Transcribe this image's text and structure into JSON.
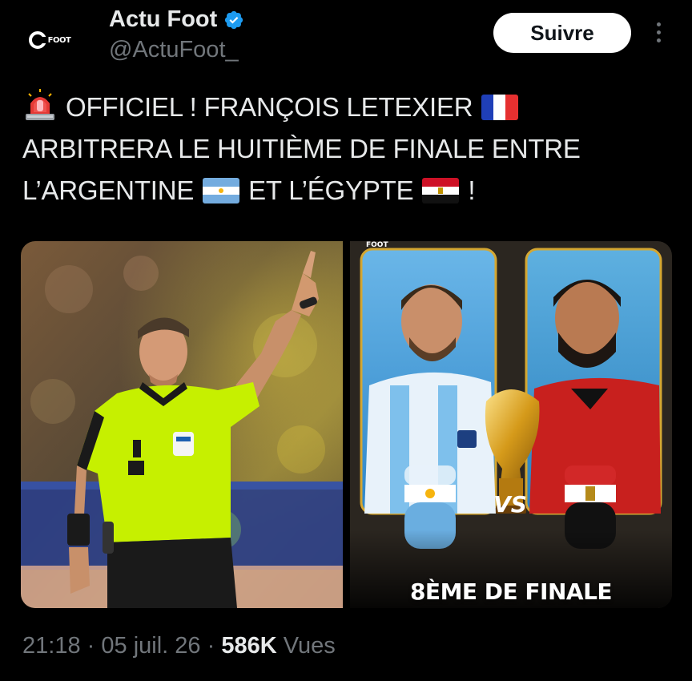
{
  "author": {
    "display_name": "Actu Foot",
    "handle": "@ActuFoot_",
    "avatar_logo_text": "FOOT",
    "verified": true
  },
  "follow_button": {
    "label": "Suivre"
  },
  "tweet": {
    "line1_text": "OFFICIEL ! FRANÇOIS LETEXIER",
    "line2_text": "ARBITRERA LE HUITIÈME DE FINALE ENTRE",
    "line3_part1": "L’ARGENTINE",
    "line3_part2": "ET L’ÉGYPTE",
    "line3_part3": "!",
    "emojis": [
      "siren-icon",
      "flag-france-icon",
      "flag-argentina-icon",
      "flag-egypt-icon"
    ]
  },
  "media": {
    "right_graphic": {
      "logo_text": "FOOT",
      "vs_text": "VS",
      "title": "8ÈME DE FINALE"
    }
  },
  "meta": {
    "time": "21:18",
    "date": "05 juil. 26",
    "separator": "·",
    "views_count": "586K",
    "views_label": "Vues"
  },
  "colors": {
    "background": "#000000",
    "text_primary": "#e7e9ea",
    "text_secondary": "#71767b",
    "verified_blue": "#1d9bf0",
    "referee_shirt": "#c6f000"
  }
}
